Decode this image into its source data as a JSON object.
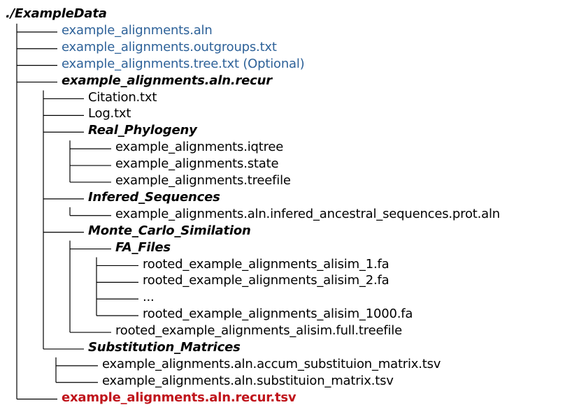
{
  "colors": {
    "text": "#000000",
    "input": "#2e6299",
    "output": "#c0141b"
  },
  "root": "./ExampleData",
  "entries": [
    {
      "depth": 1,
      "label": "example_alignments.aln",
      "kind": "file",
      "color": "blue",
      "last": false
    },
    {
      "depth": 1,
      "label": "example_alignments.outgroups.txt",
      "kind": "file",
      "color": "blue",
      "last": false
    },
    {
      "depth": 1,
      "label": "example_alignments.tree.txt (Optional)",
      "kind": "file",
      "color": "blue",
      "last": false
    },
    {
      "depth": 1,
      "label": "example_alignments.aln.recur",
      "kind": "folder",
      "color": "black",
      "last": false
    },
    {
      "depth": 2,
      "label": "Citation.txt",
      "kind": "file",
      "color": "black",
      "last": false
    },
    {
      "depth": 2,
      "label": "Log.txt",
      "kind": "file",
      "color": "black",
      "last": false
    },
    {
      "depth": 2,
      "label": "Real_Phylogeny",
      "kind": "folder",
      "color": "black",
      "last": false
    },
    {
      "depth": 3,
      "label": "example_alignments.iqtree",
      "kind": "file",
      "color": "black",
      "last": false
    },
    {
      "depth": 3,
      "label": "example_alignments.state",
      "kind": "file",
      "color": "black",
      "last": false
    },
    {
      "depth": 3,
      "label": "example_alignments.treefile",
      "kind": "file",
      "color": "black",
      "last": true
    },
    {
      "depth": 2,
      "label": "Infered_Sequences",
      "kind": "folder",
      "color": "black",
      "last": false
    },
    {
      "depth": 3,
      "label": "example_alignments.aln.infered_ancestral_sequences.prot.aln",
      "kind": "file",
      "color": "black",
      "last": true
    },
    {
      "depth": 2,
      "label": "Monte_Carlo_Similation",
      "kind": "folder",
      "color": "black",
      "last": false
    },
    {
      "depth": 3,
      "label": "FA_Files",
      "kind": "folder",
      "color": "black",
      "last": false
    },
    {
      "depth": 4,
      "label": "rooted_example_alignments_alisim_1.fa",
      "kind": "file",
      "color": "black",
      "last": false
    },
    {
      "depth": 4,
      "label": "rooted_example_alignments_alisim_2.fa",
      "kind": "file",
      "color": "black",
      "last": false
    },
    {
      "depth": 4,
      "label": "...",
      "kind": "file",
      "color": "black",
      "last": false
    },
    {
      "depth": 4,
      "label": "rooted_example_alignments_alisim_1000.fa",
      "kind": "file",
      "color": "black",
      "last": true
    },
    {
      "depth": 3,
      "label": "rooted_example_alignments_alisim.full.treefile",
      "kind": "file",
      "color": "black",
      "last": true
    },
    {
      "depth": 2,
      "label": "Substitution_Matrices",
      "kind": "folder",
      "color": "black",
      "last": true
    },
    {
      "depth": 3,
      "label": "example_alignments.aln.accum_substituion_matrix.tsv",
      "kind": "file",
      "color": "black",
      "last": false
    },
    {
      "depth": 3,
      "label": "example_alignments.aln.substituion_matrix.tsv",
      "kind": "file",
      "color": "black",
      "last": true
    },
    {
      "depth": 1,
      "label": "example_alignments.aln.recur.tsv",
      "kind": "file",
      "color": "red",
      "last": true
    }
  ]
}
